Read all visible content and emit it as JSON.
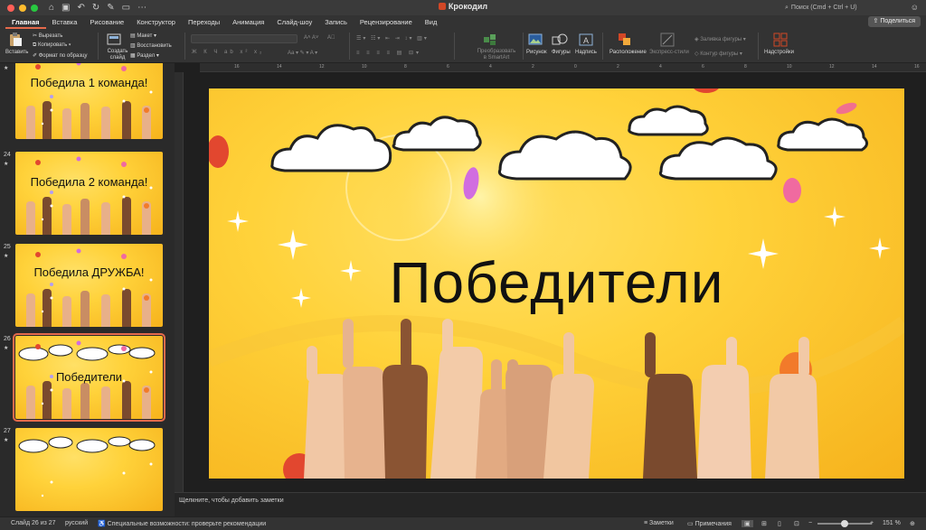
{
  "window": {
    "title": "Крокодил"
  },
  "search": {
    "placeholder": "Поиск (Cmd + Ctrl + U)"
  },
  "tabs": [
    "Главная",
    "Вставка",
    "Рисование",
    "Конструктор",
    "Переходы",
    "Анимация",
    "Слайд-шоу",
    "Запись",
    "Рецензирование",
    "Вид"
  ],
  "share_label": "Поделиться",
  "ribbon": {
    "paste": "Вставить",
    "cut": "Вырезать",
    "copy": "Копировать",
    "format_painter": "Формат по образцу",
    "new_slide": "Создать слайд",
    "layout": "Макет",
    "reset": "Восстановить",
    "section": "Раздел",
    "convert_smartart": "Преобразовать в SmartArt",
    "picture": "Рисунок",
    "shapes": "Фигуры",
    "textbox": "Надпись",
    "arrange": "Расположение",
    "quick_styles": "Экспресс-стили",
    "shape_fill": "Заливка фигуры",
    "shape_outline": "Контур фигуры",
    "addins": "Надстройки"
  },
  "slides": [
    {
      "number": "",
      "text": "Победила 1 команда!"
    },
    {
      "number": "24",
      "text": "Победила 2 команда!"
    },
    {
      "number": "25",
      "text": "Победила ДРУЖБА!"
    },
    {
      "number": "26",
      "text": "Победители"
    },
    {
      "number": "27",
      "text": ""
    }
  ],
  "current_slide": {
    "title": "Победители"
  },
  "notes_placeholder": "Щелкните, чтобы добавить заметки",
  "ruler_ticks": [
    "16",
    "14",
    "12",
    "10",
    "8",
    "6",
    "4",
    "2",
    "0",
    "2",
    "4",
    "6",
    "8",
    "10",
    "12",
    "14",
    "16"
  ],
  "status": {
    "slide_of": "Слайд 26 из 27",
    "language": "русский",
    "accessibility": "Специальные возможности: проверьте рекомендации",
    "notes": "Заметки",
    "comments": "Примечания",
    "zoom": "151 %"
  },
  "colors": {
    "accent": "#e56a4b",
    "slide_yellow": "#ffd23a"
  }
}
